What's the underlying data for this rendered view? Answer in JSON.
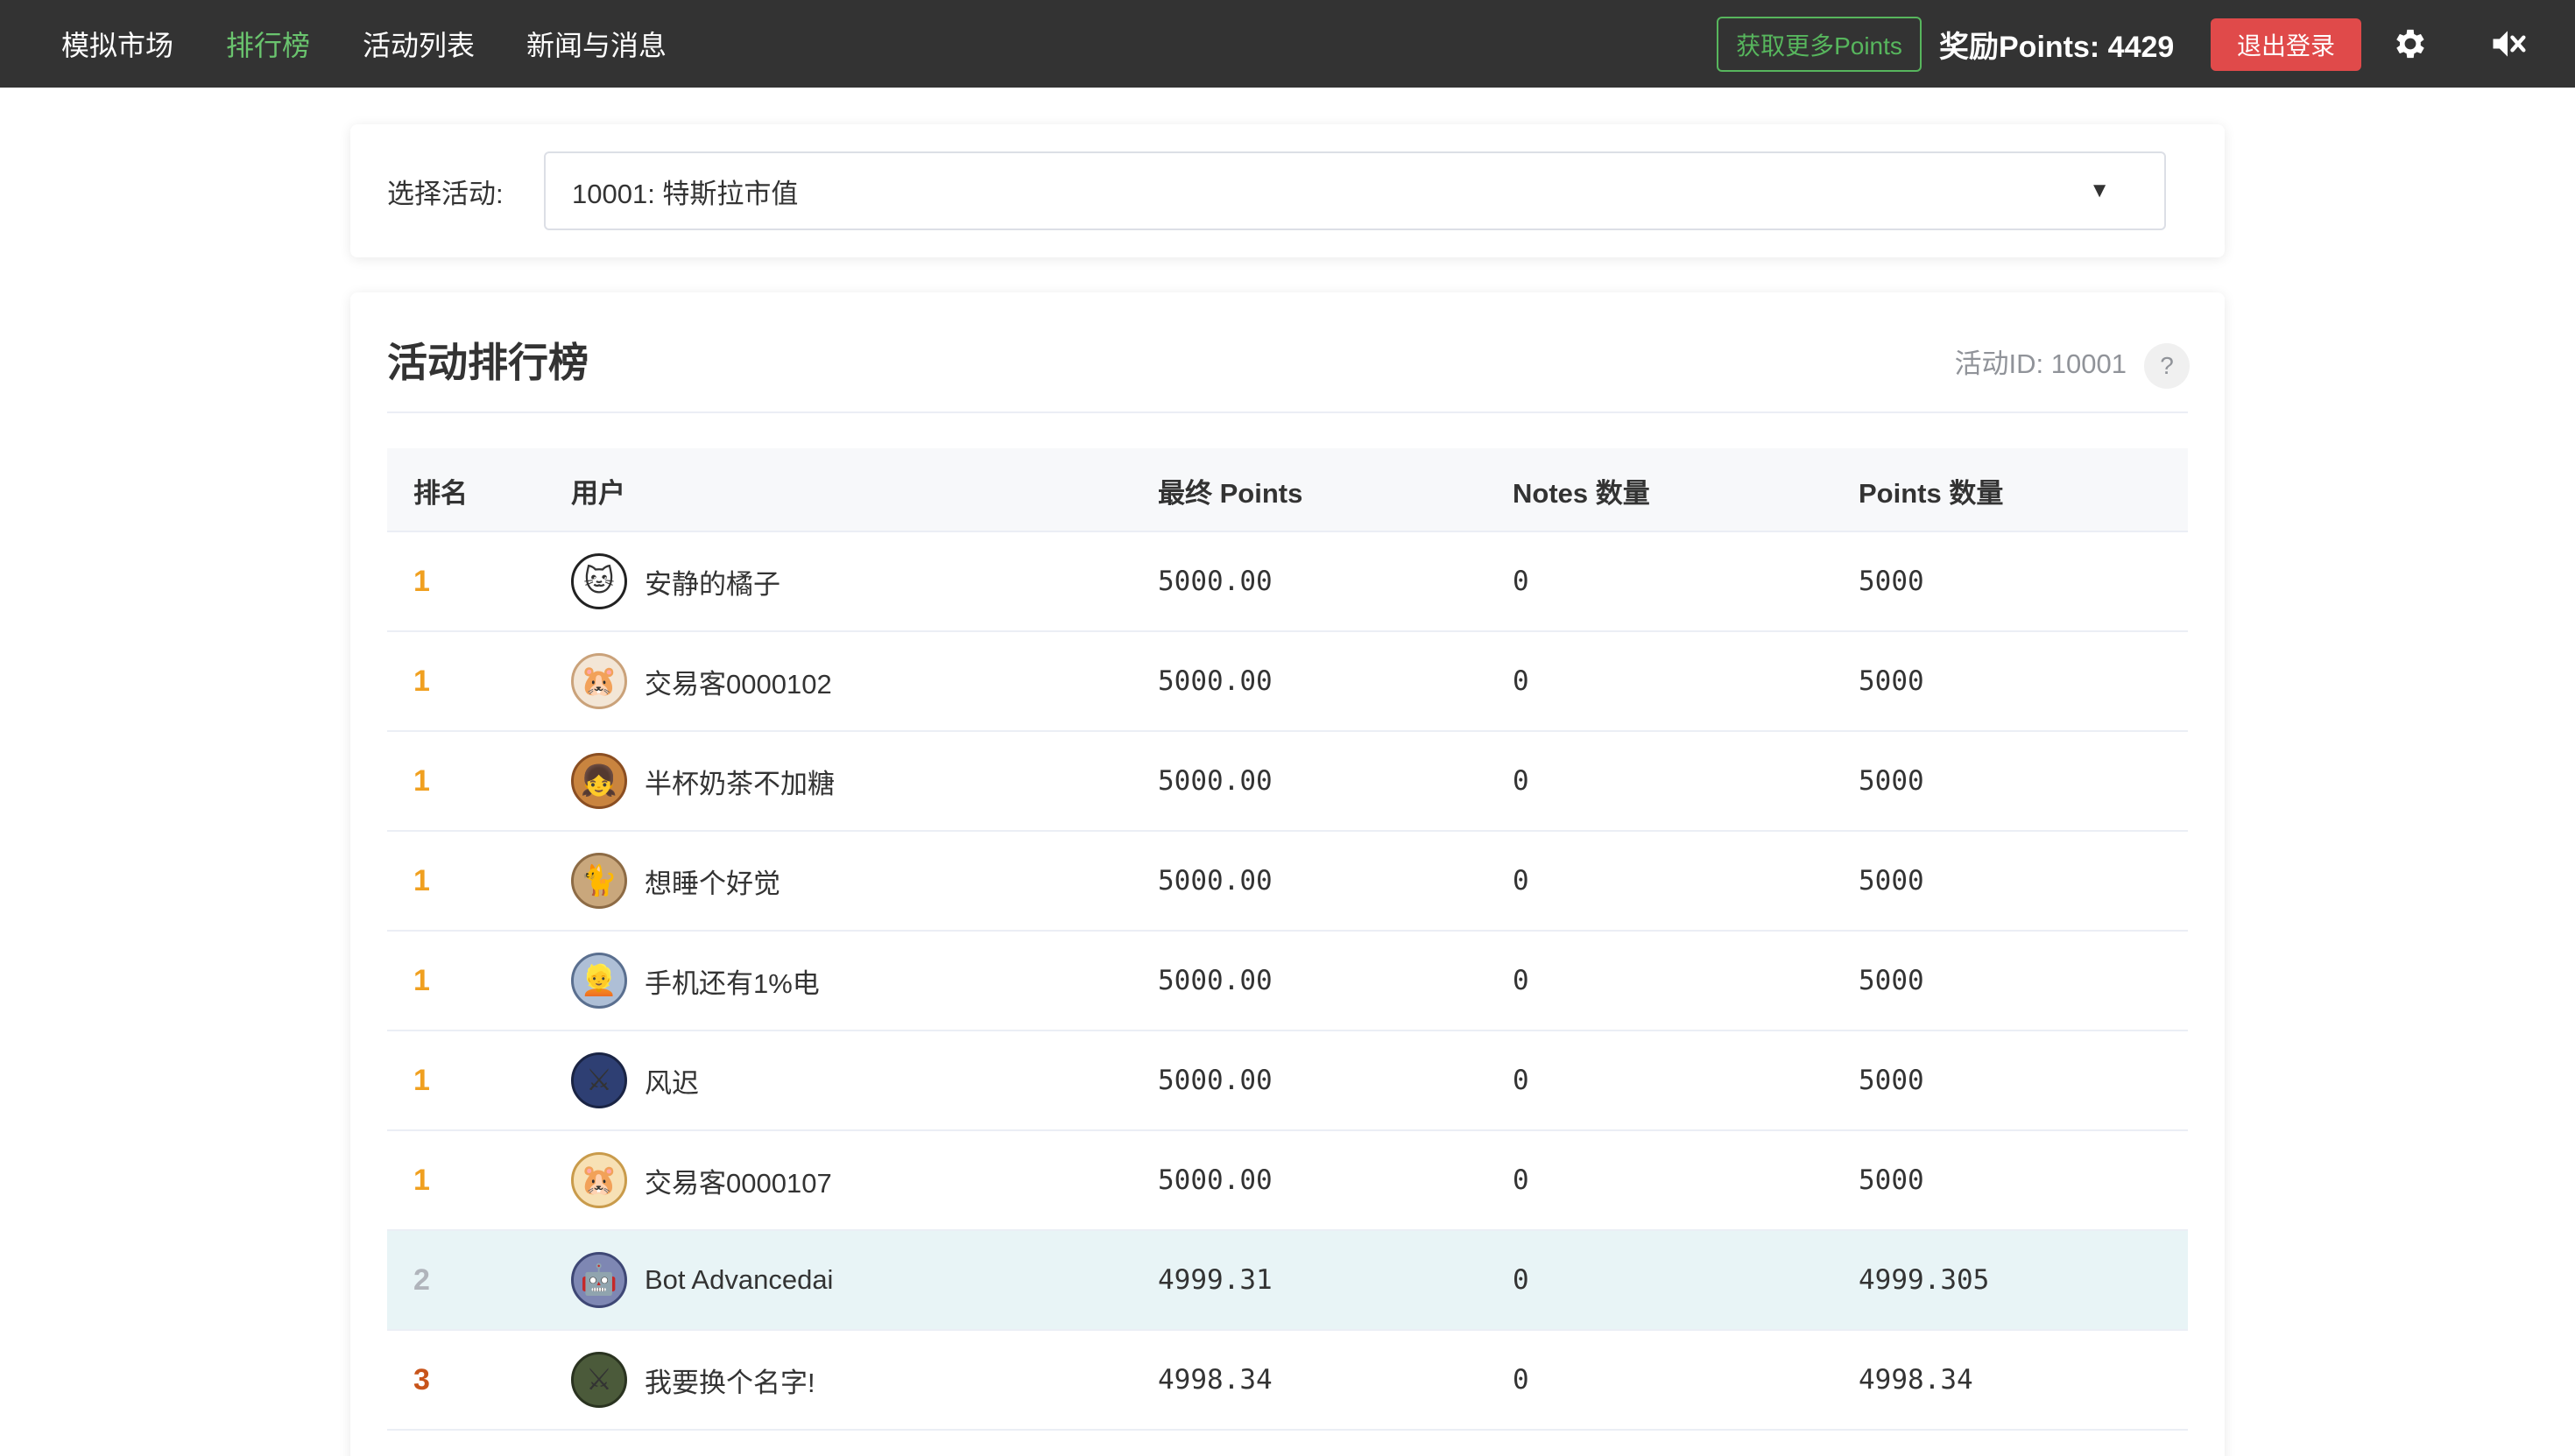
{
  "nav": {
    "items": [
      {
        "label": "模拟市场",
        "active": false
      },
      {
        "label": "排行榜",
        "active": true
      },
      {
        "label": "活动列表",
        "active": false
      },
      {
        "label": "新闻与消息",
        "active": false
      }
    ],
    "more_points_label": "获取更多Points",
    "reward_points": "奖励Points: 4429",
    "logout_label": "退出登录",
    "icons": [
      "gear-icon",
      "mute-icon"
    ]
  },
  "selector": {
    "label": "选择活动:",
    "selected": "10001: 特斯拉市值"
  },
  "board": {
    "title": "活动排行榜",
    "activity_id": "活动ID: 10001",
    "help": "?",
    "headers": [
      "排名",
      "用户",
      "最终 Points",
      "Notes 数量",
      "Points 数量"
    ],
    "rows": [
      {
        "rank": "1",
        "user": "安静的橘子",
        "final": "5000.00",
        "notes": "0",
        "points": "5000",
        "rank_color": "#f0a020",
        "avatar": "cat-bw"
      },
      {
        "rank": "1",
        "user": "交易客0000102",
        "final": "5000.00",
        "notes": "0",
        "points": "5000",
        "rank_color": "#f0a020",
        "avatar": "hamster"
      },
      {
        "rank": "1",
        "user": "半杯奶茶不加糖",
        "final": "5000.00",
        "notes": "0",
        "points": "5000",
        "rank_color": "#f0a020",
        "avatar": "anime"
      },
      {
        "rank": "1",
        "user": "想睡个好觉",
        "final": "5000.00",
        "notes": "0",
        "points": "5000",
        "rank_color": "#f0a020",
        "avatar": "cat"
      },
      {
        "rank": "1",
        "user": "手机还有1%电",
        "final": "5000.00",
        "notes": "0",
        "points": "5000",
        "rank_color": "#f0a020",
        "avatar": "anime-blue"
      },
      {
        "rank": "1",
        "user": "风迟",
        "final": "5000.00",
        "notes": "0",
        "points": "5000",
        "rank_color": "#f0a020",
        "avatar": "game"
      },
      {
        "rank": "1",
        "user": "交易客0000107",
        "final": "5000.00",
        "notes": "0",
        "points": "5000",
        "rank_color": "#f0a020",
        "avatar": "hamster2"
      },
      {
        "rank": "2",
        "user": "Bot Advancedai",
        "final": "4999.31",
        "notes": "0",
        "points": "4999.305",
        "rank_color": "#b0b4bb",
        "avatar": "bot",
        "highlight": true
      },
      {
        "rank": "3",
        "user": "我要换个名字!",
        "final": "4998.34",
        "notes": "0",
        "points": "4998.34",
        "rank_color": "#c8541a",
        "avatar": "game2"
      }
    ]
  },
  "colors": {
    "nav_bg": "#333333",
    "nav_active": "#6ac46e",
    "logout_bg": "#e04a4a",
    "rank_gold": "#f0a020",
    "rank_silver": "#b0b4bb",
    "rank_bronze": "#c8541a",
    "highlight_row": "#e8f4f6"
  }
}
